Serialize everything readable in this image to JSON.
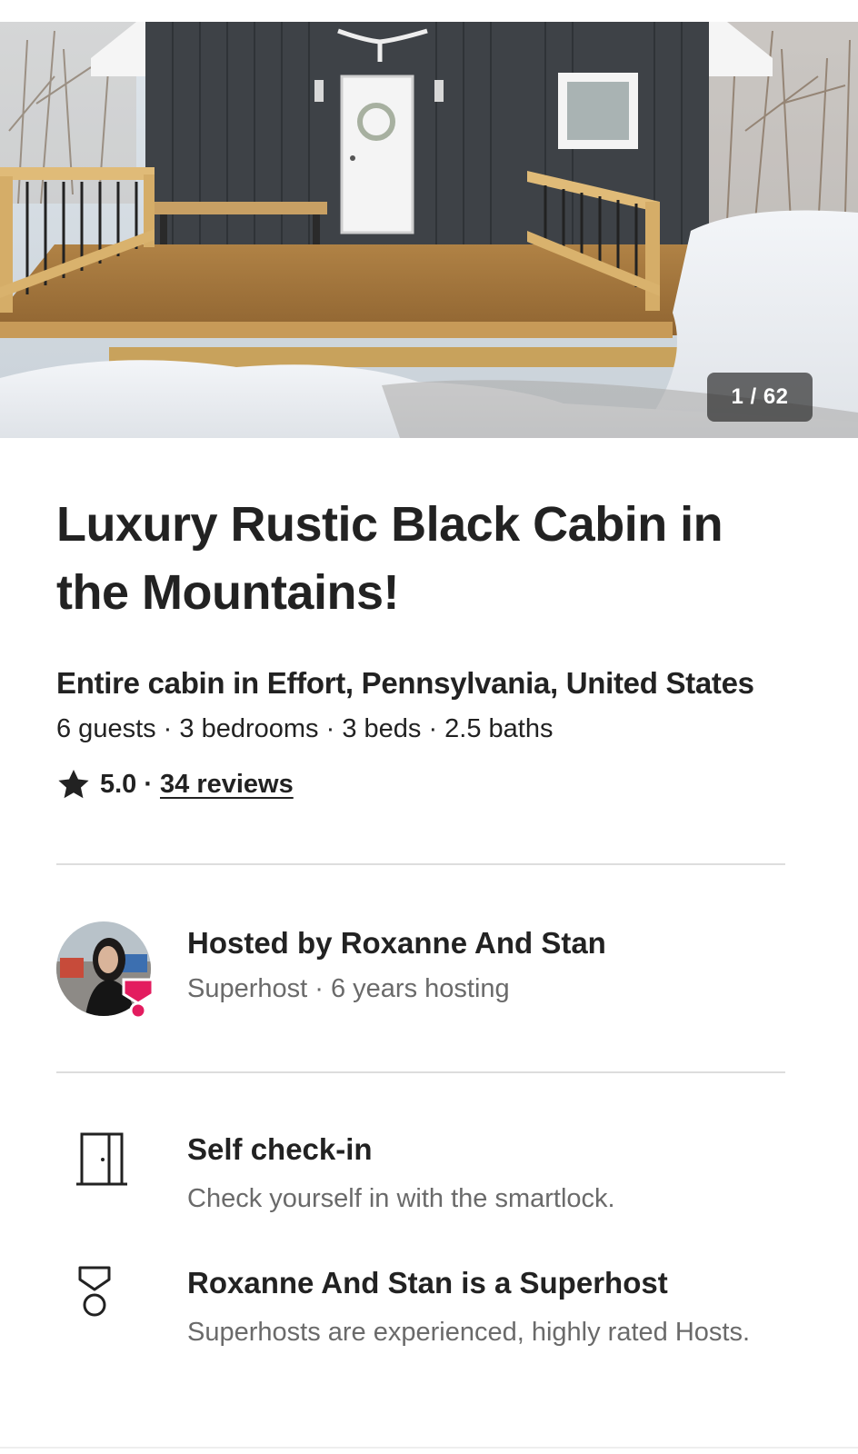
{
  "gallery": {
    "counter": "1 / 62"
  },
  "listing": {
    "title": "Luxury Rustic Black Cabin in the Mountains!",
    "subtitle": "Entire cabin in Effort, Pennsylvania, United States",
    "details": "6 guests · 3 bedrooms · 3 beds · 2.5 baths",
    "rating": "5.0",
    "separator": "·",
    "reviews_link": "34 reviews"
  },
  "host": {
    "name": "Hosted by Roxanne And Stan",
    "meta": "Superhost · 6 years hosting"
  },
  "features": [
    {
      "icon": "door-icon",
      "title": "Self check-in",
      "description": "Check yourself in with the smartlock."
    },
    {
      "icon": "superhost-medal-icon",
      "title": "Roxanne And Stan is a Superhost",
      "description": "Superhosts are experienced, highly rated Hosts."
    }
  ],
  "colors": {
    "text_primary": "#222222",
    "text_secondary": "#6a6a6a",
    "divider": "#dddddd",
    "superhost_badge": "#e31c5f",
    "counter_bg": "#222222"
  }
}
